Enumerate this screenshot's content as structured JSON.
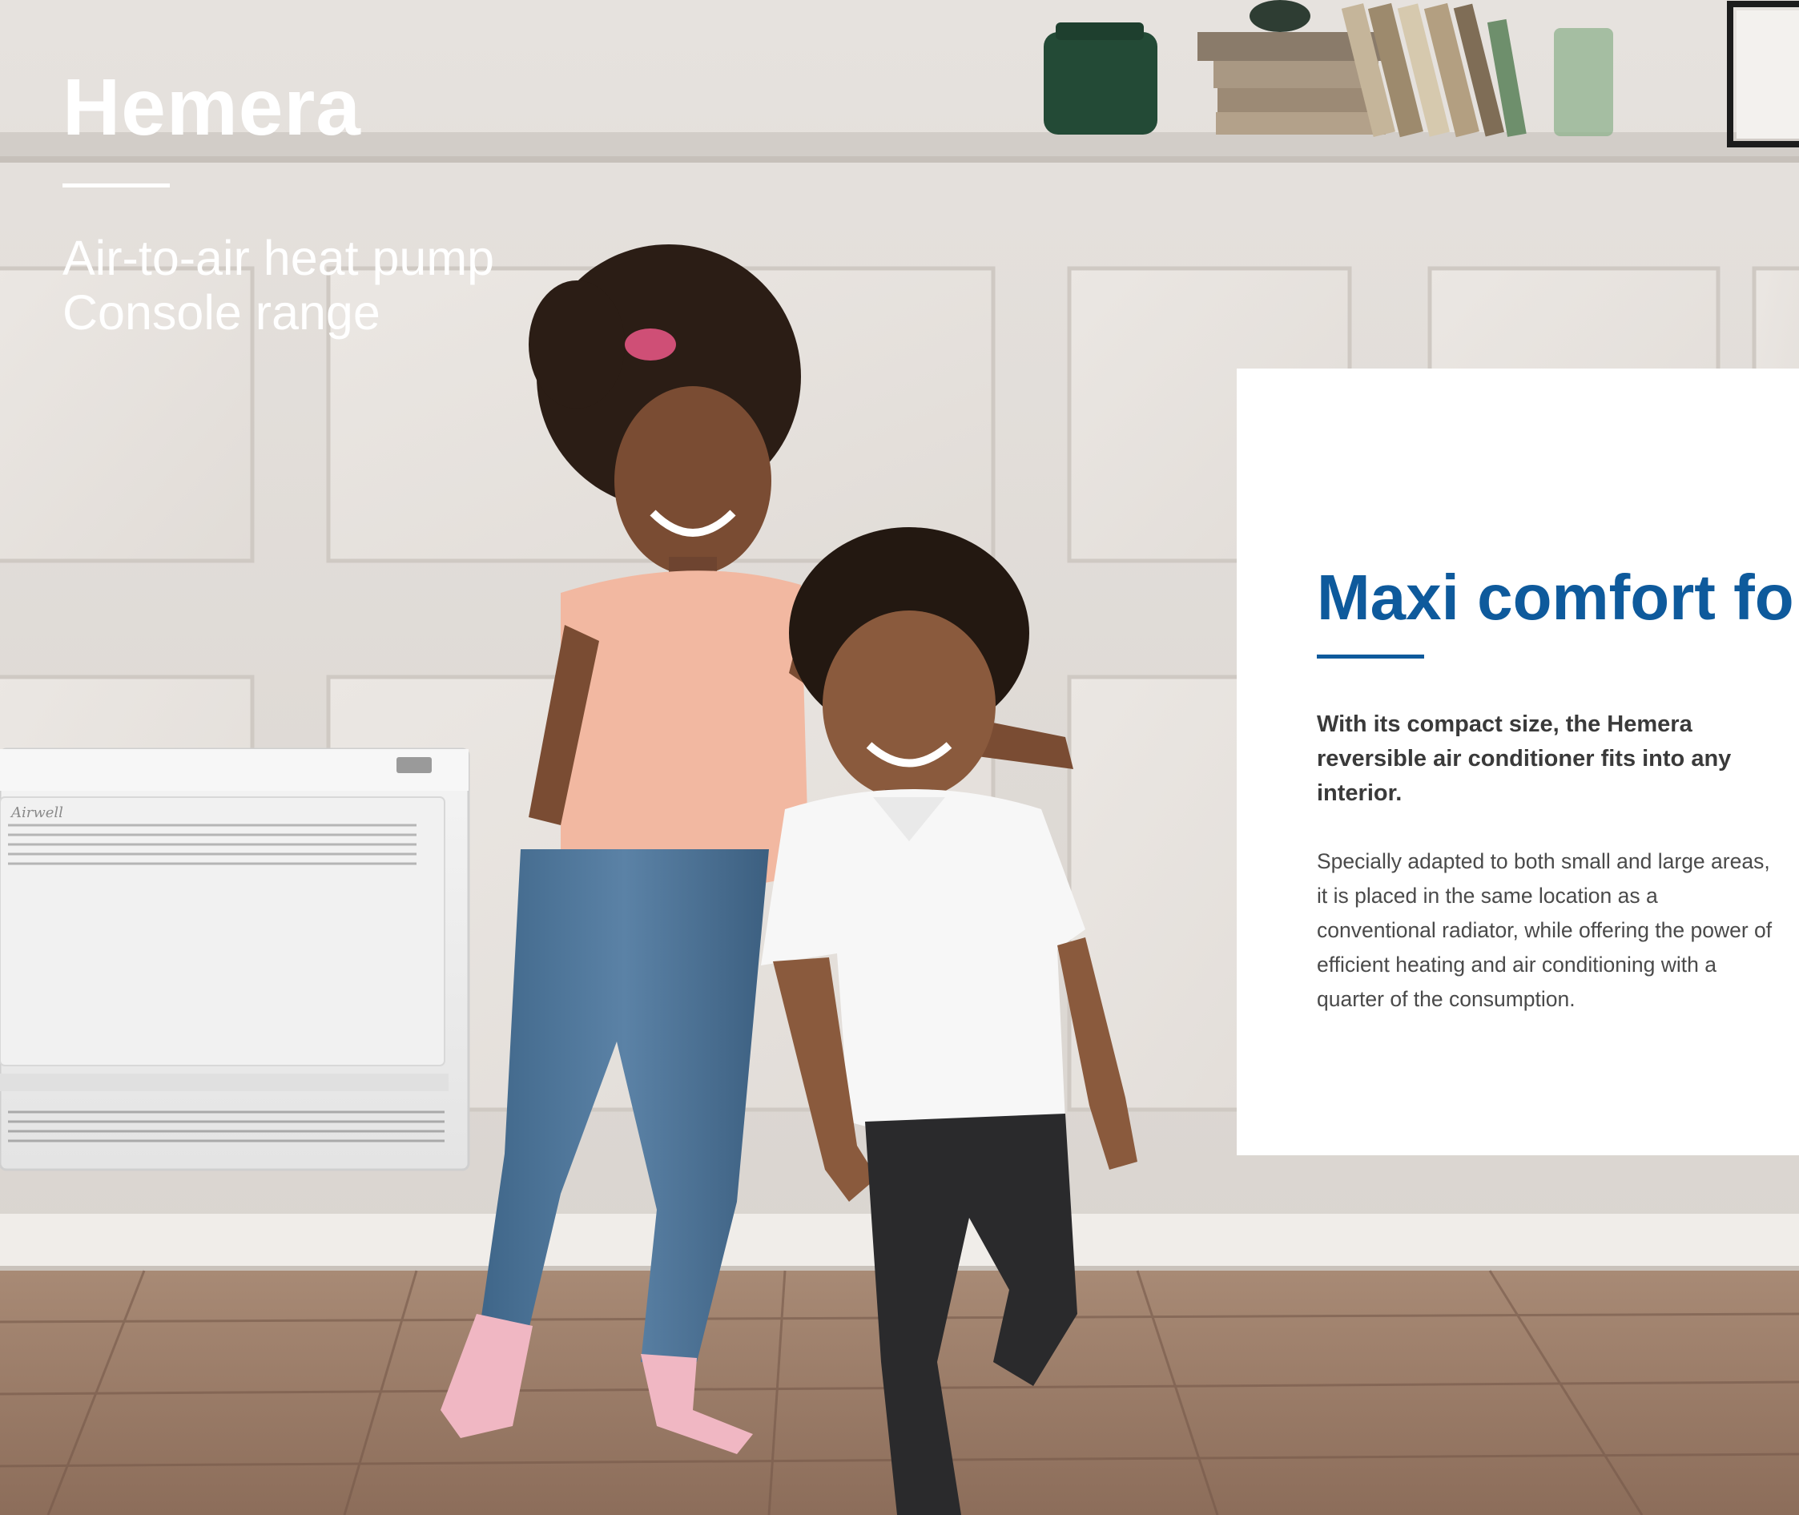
{
  "header": {
    "title": "Hemera",
    "subtitle_line1": "Air-to-air heat pump",
    "subtitle_line2": "Console range"
  },
  "panel": {
    "heading": "Maxi comfort fo",
    "lead": "With its compact size, the Hemera reversible air conditioner fits into any interior.",
    "body": "Specially adapted to both small and large areas, it is placed in the same location as a conventional radiator, while offering the power of efficient heating and air conditioning with a quarter of the consumption."
  },
  "device": {
    "brand": "Airwell"
  },
  "colors": {
    "accent": "#0e5a9c",
    "text_dark": "#3a3a3a",
    "text_body": "#4a4a4a"
  }
}
